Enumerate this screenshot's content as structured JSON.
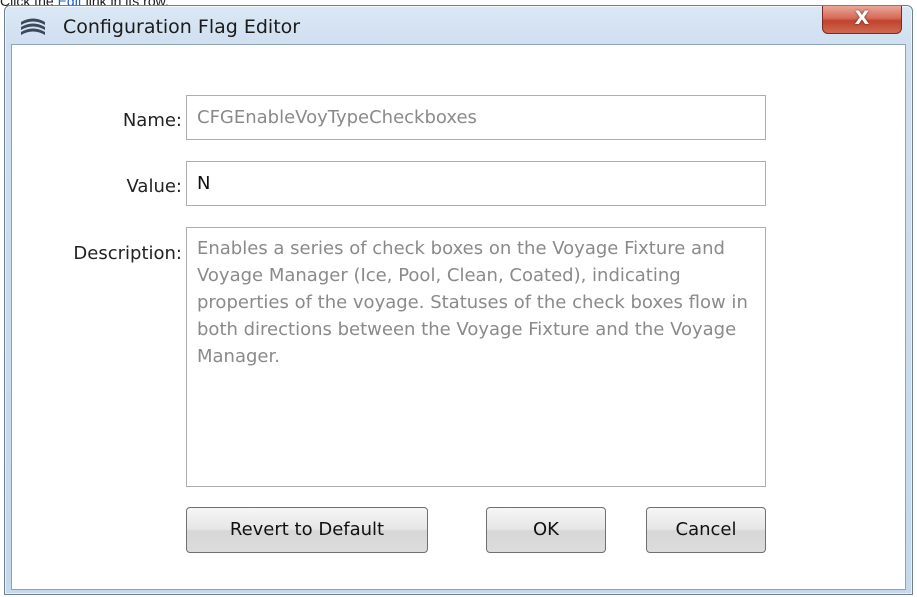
{
  "caption": {
    "prefix": "Click the",
    "link": "Edit",
    "suffix": "link in its row."
  },
  "window": {
    "title": "Configuration Flag Editor",
    "close_label": "X",
    "icon": "app-logo-icon"
  },
  "form": {
    "name_label": "Name:",
    "name_value": "CFGEnableVoyTypeCheckboxes",
    "value_label": "Value:",
    "value_value": "N",
    "description_label": "Description:",
    "description_value": "Enables a series of check boxes on the Voyage Fixture and Voyage Manager (Ice, Pool, Clean, Coated), indicating properties of the voyage. Statuses of the check boxes flow in both directions between the Voyage Fixture and the Voyage Manager."
  },
  "buttons": {
    "revert": "Revert to Default",
    "ok": "OK",
    "cancel": "Cancel"
  }
}
